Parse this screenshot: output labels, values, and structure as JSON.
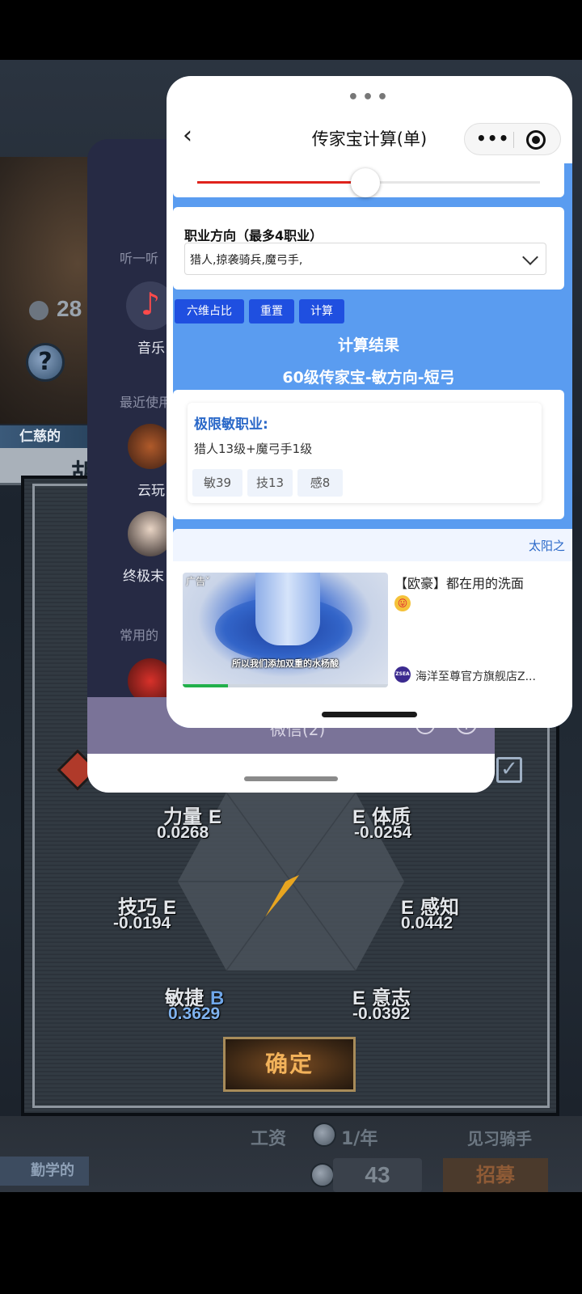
{
  "game": {
    "partial_count": "28",
    "help_glyph": "?",
    "trait_top": "仁慈的",
    "name_partial": "胡",
    "stats": [
      {
        "label": "力量",
        "grade": "E",
        "value": "0.0268"
      },
      {
        "label": "体质",
        "grade": "E",
        "value": "-0.0254"
      },
      {
        "label": "技巧",
        "grade": "E",
        "value": "-0.0194"
      },
      {
        "label": "感知",
        "grade": "E",
        "value": "0.0442"
      },
      {
        "label": "敏捷",
        "grade": "B",
        "value": "0.3629"
      },
      {
        "label": "意志",
        "grade": "E",
        "value": "-0.0392"
      }
    ],
    "confirm_label": "确定",
    "wage_label": "工资",
    "wage_value": "1/年",
    "rank_label": "见习骑手",
    "trait_bottom": "勤学的",
    "price": "43",
    "recruit_label": "招募",
    "checkbox_glyph": "✓"
  },
  "wechat": {
    "section_listen": "听一听",
    "music_label": "音乐",
    "music_glyph": "♪",
    "section_recent": "最近使用",
    "app1_label": "云玩",
    "app2_label": "终极末",
    "section_common": "常用的",
    "bottom_title": "微信(2)",
    "plus_glyph": "+"
  },
  "miniprogram": {
    "dots": "•••",
    "back_glyph": "‹",
    "title": "传家宝计算(单)",
    "more_glyph": "•••",
    "slider_value_fraction": 0.49,
    "job_title": "职业方向（最多4职业）",
    "job_value": "猎人,掠袭骑兵,魔弓手,",
    "buttons": [
      "六维占比",
      "重置",
      "计算"
    ],
    "result_title": "计算结果",
    "result_subtitle": "60级传家宝-敏方向-短弓",
    "result_heading": "极限敏职业:",
    "result_line": "猎人13级+魔弓手1级",
    "tags": [
      "敏39",
      "技13",
      "感8"
    ],
    "ad": {
      "header_link": "太阳之",
      "badge": "广告˅",
      "caption": "所以我们添加双重的水杨酸",
      "progress_fraction": 0.22,
      "text": "【欧豪】都在用的洗面",
      "emoji": "😛",
      "store_icon_text": "ZSEA",
      "store_name": "海洋至尊官方旗舰店Z..."
    }
  },
  "colors": {
    "accent_blue": "#1f4fe0",
    "page_blue": "#5a9cf0",
    "slider_red": "#e0231c",
    "grade_b": "#6fa6e8",
    "confirm_gold": "#f2b25a"
  }
}
